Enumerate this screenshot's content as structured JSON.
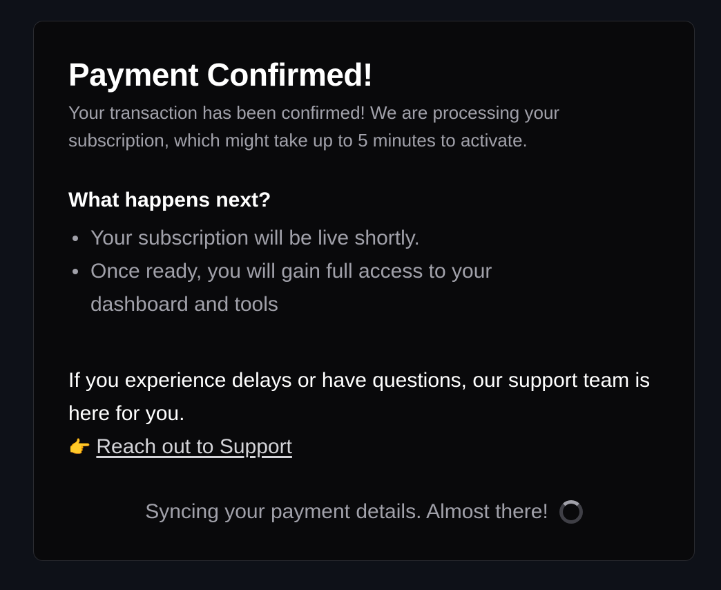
{
  "card": {
    "title": "Payment Confirmed!",
    "subtitle": "Your transaction has been confirmed! We are processing your subscription, which might take up to 5 minutes to activate.",
    "next_heading": "What happens next?",
    "next_items": [
      "Your subscription will be live shortly.",
      "Once ready, you will gain full access to your dashboard and tools"
    ],
    "support_text": "If you experience delays or have questions, our support team is here for you.",
    "support_emoji": "👉",
    "support_link_label": "Reach out to Support",
    "sync_text": "Syncing your payment details. Almost there!"
  },
  "icons": {
    "pointing": "pointing-right-icon",
    "spinner": "loading-spinner-icon"
  },
  "colors": {
    "page_background": "#0e1118",
    "card_background": "#09090b",
    "text_primary": "#ffffff",
    "text_muted": "#a1a1aa"
  }
}
